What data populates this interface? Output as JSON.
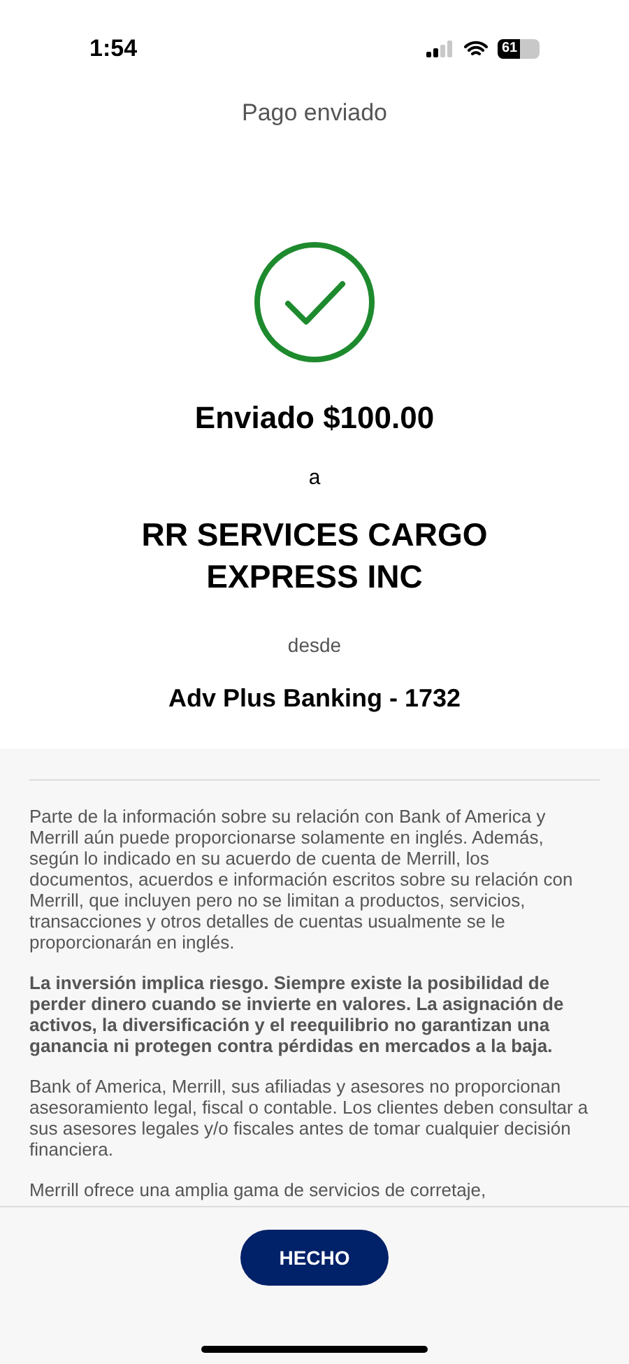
{
  "status_bar": {
    "time": "1:54",
    "battery": "61"
  },
  "header": {
    "title": "Pago enviado"
  },
  "confirmation": {
    "amount_line": "Enviado $100.00",
    "to_label": "a",
    "recipient": "RR SERVICES CARGO EXPRESS INC",
    "from_label": "desde",
    "account": "Adv Plus Banking - 1732"
  },
  "disclosures": [
    {
      "text": "Parte de la información sobre su relación con Bank of America y Merrill aún puede proporcionarse solamente en inglés. Además, según lo indicado en su acuerdo de cuenta de Merrill, los documentos, acuerdos e información escritos sobre su relación con Merrill, que incluyen pero no se limitan a productos, servicios, transacciones y otros detalles de cuentas usualmente se le proporcionarán en inglés.",
      "bold": false
    },
    {
      "text": "La inversión implica riesgo. Siempre existe la posibilidad de perder dinero cuando se invierte en valores. La asignación de activos, la diversificación y el reequilibrio no garantizan una ganancia ni protegen contra pérdidas en mercados a la baja.",
      "bold": true
    },
    {
      "text": "Bank of America, Merrill, sus afiliadas y asesores no proporcionan asesoramiento legal, fiscal o contable. Los clientes deben consultar a sus asesores legales y/o fiscales antes de tomar cualquier decisión financiera.",
      "bold": false
    },
    {
      "text": "Merrill ofrece una amplia gama de servicios de corretaje,",
      "bold": false
    }
  ],
  "footer": {
    "button": "HECHO"
  }
}
